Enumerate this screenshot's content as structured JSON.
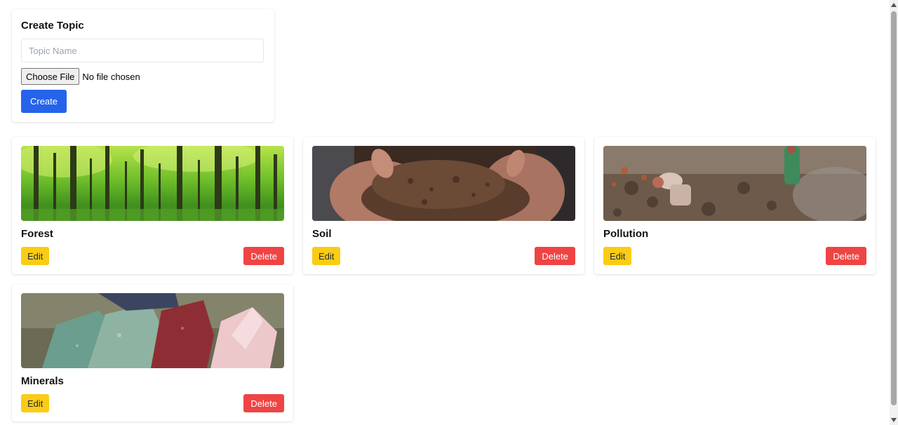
{
  "create_topic": {
    "title": "Create Topic",
    "input_placeholder": "Topic Name",
    "input_value": "",
    "file_button_label": "Choose File",
    "file_status": "No file chosen",
    "create_button_label": "Create"
  },
  "topics": [
    {
      "name": "Forest",
      "image_icon": "forest-photo",
      "edit_label": "Edit",
      "delete_label": "Delete"
    },
    {
      "name": "Soil",
      "image_icon": "soil-photo",
      "edit_label": "Edit",
      "delete_label": "Delete"
    },
    {
      "name": "Pollution",
      "image_icon": "pollution-photo",
      "edit_label": "Edit",
      "delete_label": "Delete"
    },
    {
      "name": "Minerals",
      "image_icon": "minerals-photo",
      "edit_label": "Edit",
      "delete_label": "Delete"
    }
  ],
  "colors": {
    "primary": "#2563eb",
    "edit": "#facc15",
    "delete": "#ef4444"
  }
}
